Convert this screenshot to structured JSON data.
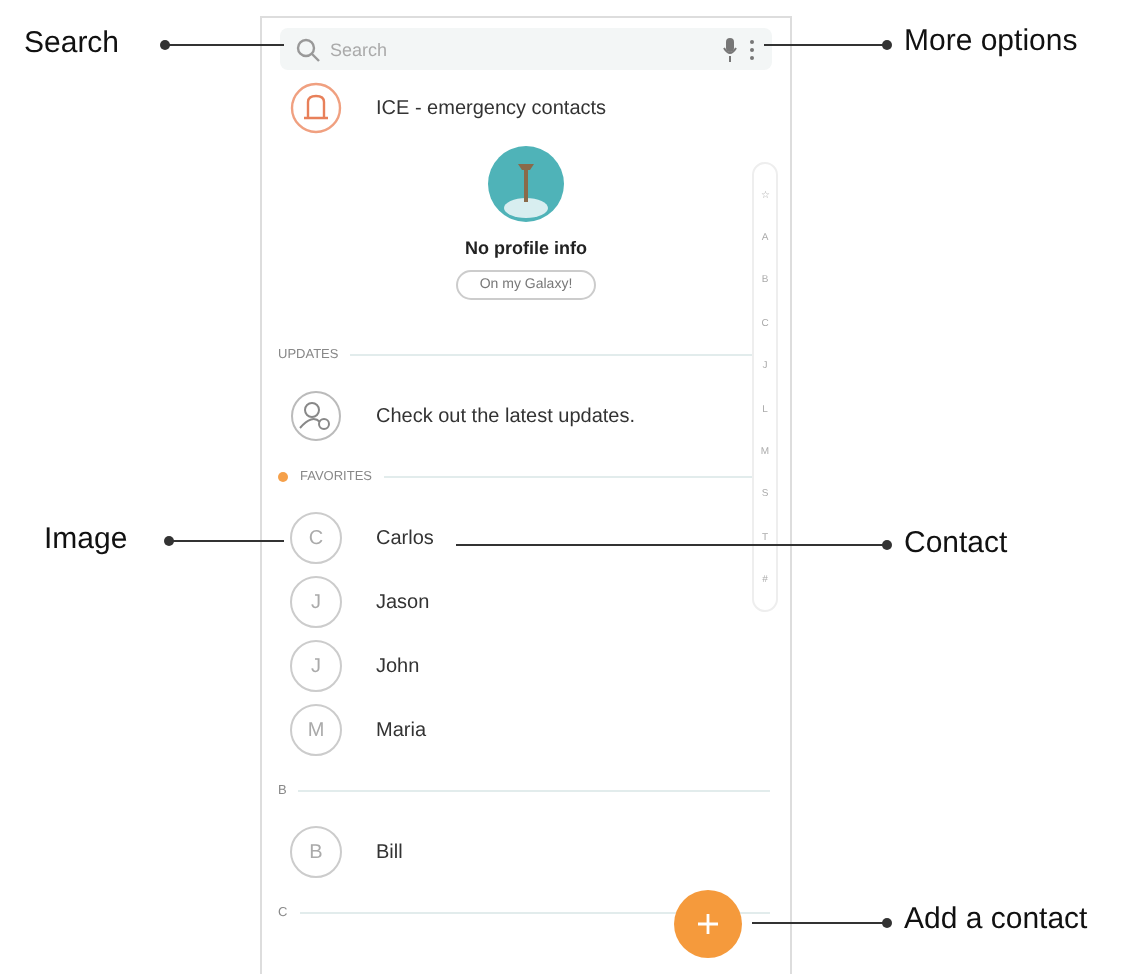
{
  "search": {
    "placeholder": "Search"
  },
  "ice": {
    "label": "ICE - emergency contacts"
  },
  "profile": {
    "title": "No profile info",
    "button": "On my Galaxy!"
  },
  "sections": [
    {
      "header": "UPDATES",
      "highlighted": false,
      "kind": "updates",
      "items": [
        {
          "text": "Check out the latest updates."
        }
      ]
    },
    {
      "header": "FAVORITES",
      "highlighted": true,
      "kind": "contacts",
      "items": [
        {
          "initial": "C",
          "name": "Carlos"
        },
        {
          "initial": "J",
          "name": "Jason"
        },
        {
          "initial": "J",
          "name": "John"
        },
        {
          "initial": "M",
          "name": "Maria"
        }
      ]
    },
    {
      "header": "B",
      "highlighted": false,
      "kind": "contacts",
      "items": [
        {
          "initial": "B",
          "name": "Bill"
        }
      ]
    },
    {
      "header": "C",
      "highlighted": false
    }
  ],
  "index": [
    "☆",
    "A",
    "B",
    "C",
    "J",
    "L",
    "M",
    "S",
    "T",
    "#"
  ],
  "callouts": [
    {
      "label": "Search"
    },
    {
      "label": "More options"
    },
    {
      "label": "Image"
    },
    {
      "label": "Contact"
    },
    {
      "label": "Add a contact"
    }
  ]
}
